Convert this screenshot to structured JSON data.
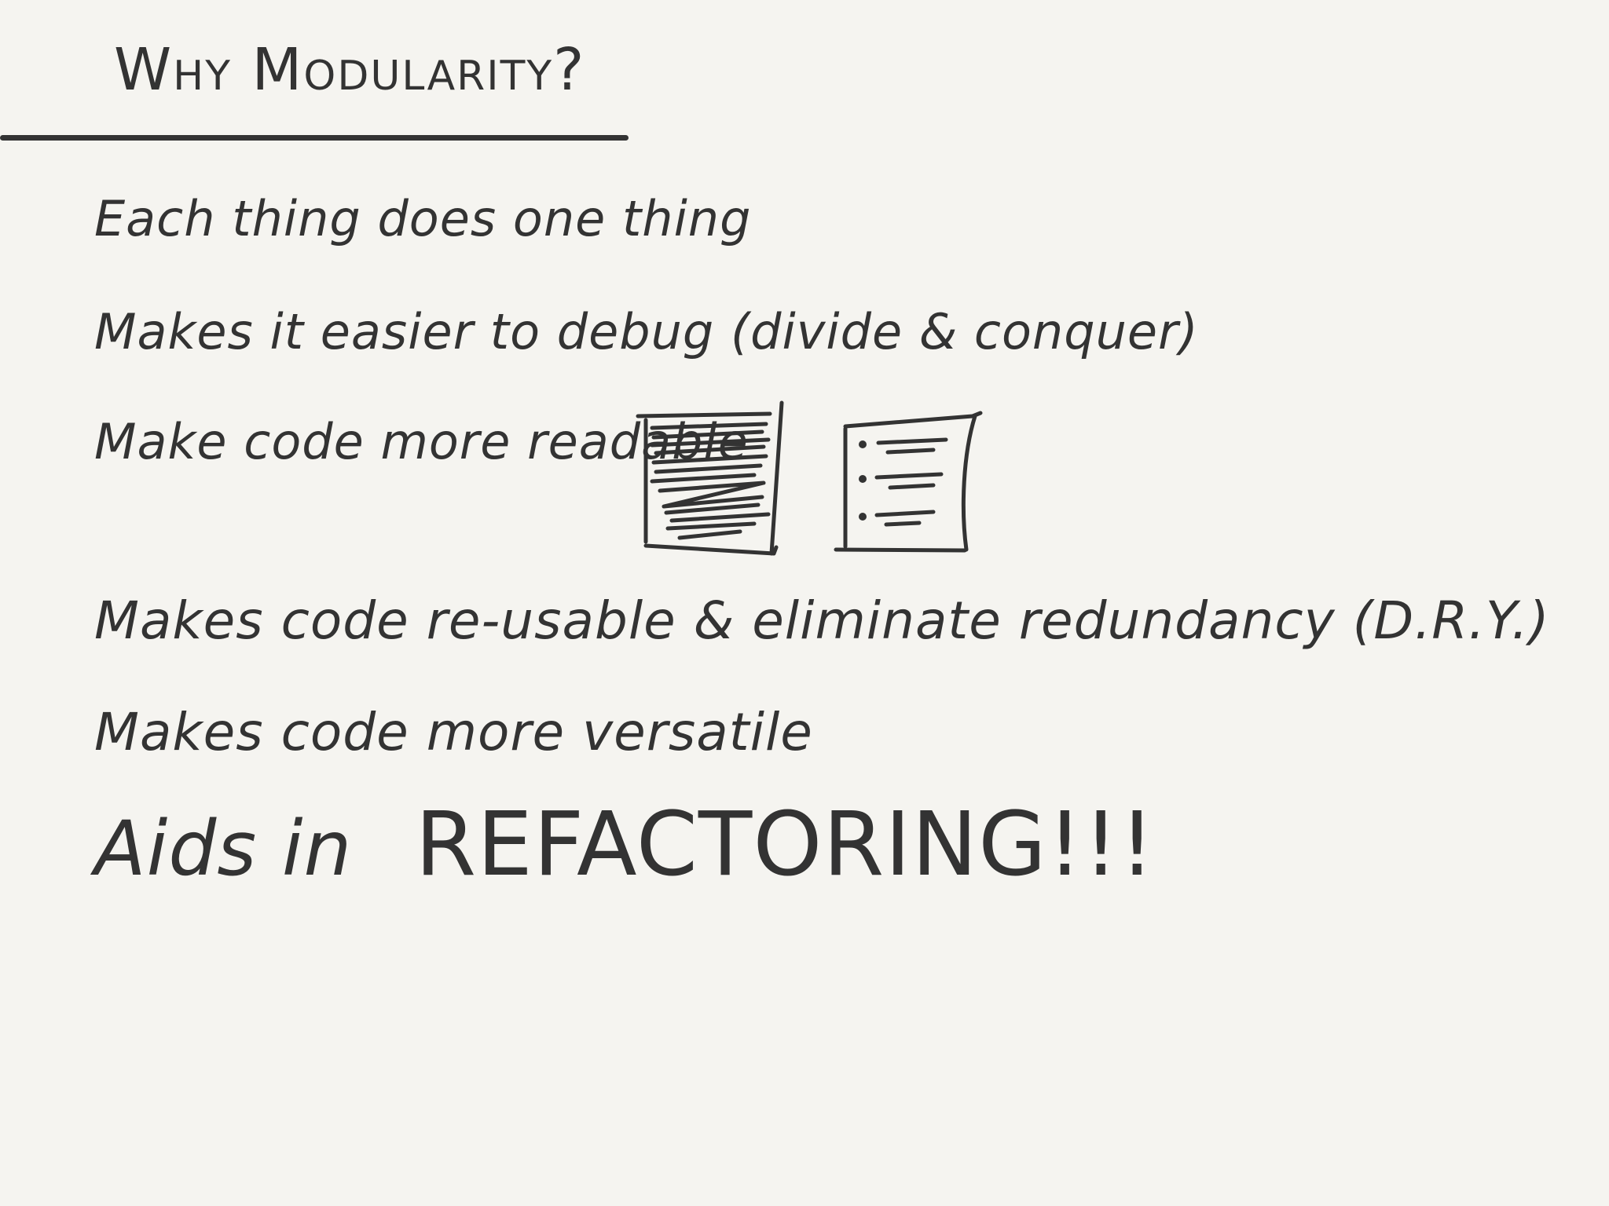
{
  "note": {
    "title": "Why Modularity?",
    "lines": [
      "Each thing does one thing",
      "Makes it easier to debug (divide & conquer)",
      "Make code more readable",
      "Makes code re-usable & eliminate redundancy (D.R.Y.)",
      "Makes code more versatile"
    ],
    "final_prefix": "Aids in",
    "final_emphasis": "REFACTORING!!!"
  },
  "sketches": {
    "messy_code": "messy-code-sketch",
    "organized_code": "organized-code-sketch"
  }
}
